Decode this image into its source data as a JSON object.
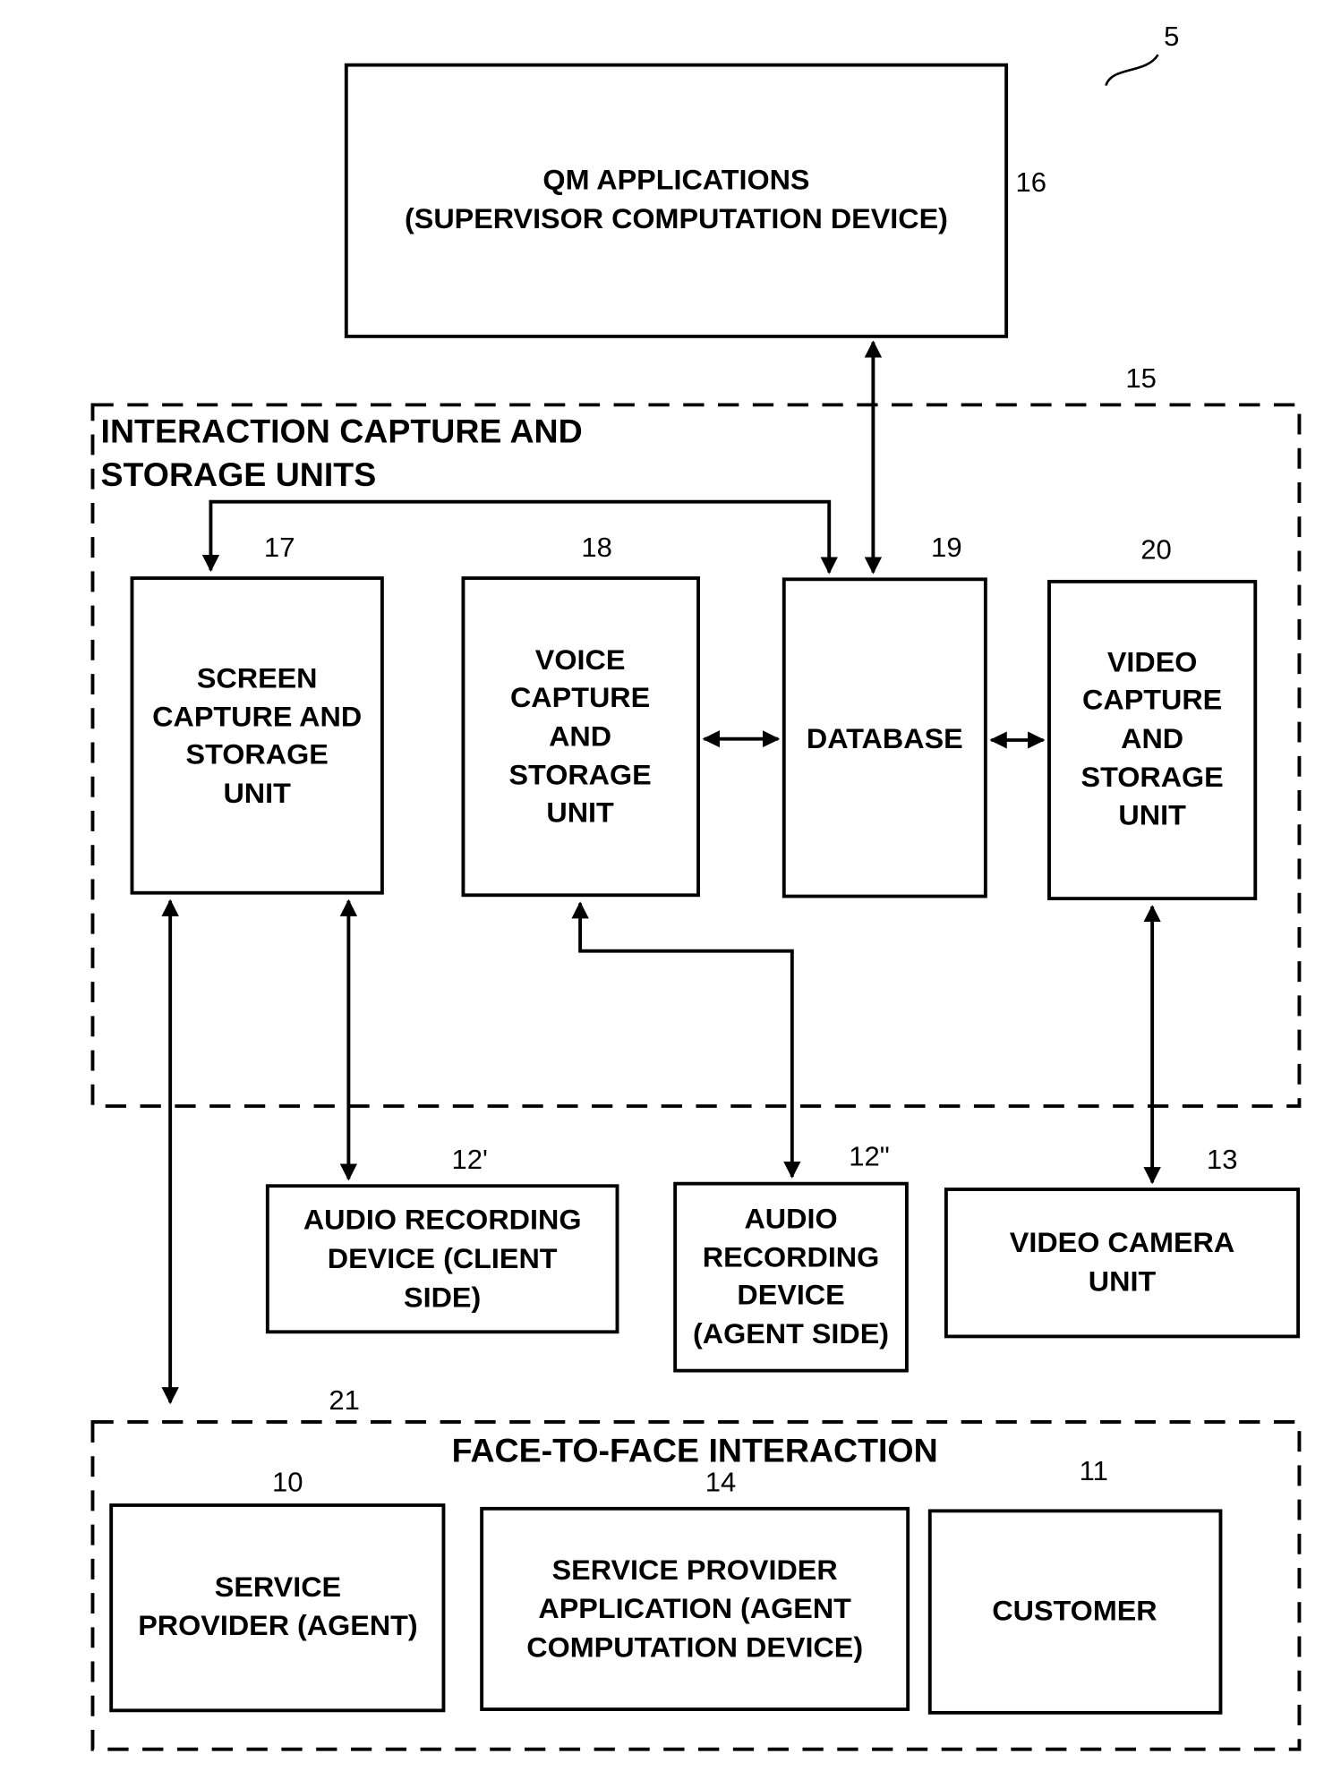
{
  "figure": {
    "ref": "5",
    "colors": {
      "ink": "#000000",
      "background": "#ffffff"
    }
  },
  "nodes": {
    "qm": {
      "ref": "16",
      "lines": [
        "QM APPLICATIONS",
        "(SUPERVISOR COMPUTATION DEVICE)"
      ]
    },
    "capture_group": {
      "ref": "15",
      "lines": [
        "INTERACTION CAPTURE AND",
        "STORAGE UNITS"
      ]
    },
    "screen": {
      "ref": "17",
      "lines": [
        "SCREEN",
        "CAPTURE AND",
        "STORAGE",
        "UNIT"
      ]
    },
    "voice": {
      "ref": "18",
      "lines": [
        "VOICE",
        "CAPTURE",
        "AND",
        "STORAGE",
        "UNIT"
      ]
    },
    "database": {
      "ref": "19",
      "lines": [
        "DATABASE"
      ]
    },
    "video": {
      "ref": "20",
      "lines": [
        "VIDEO",
        "CAPTURE",
        "AND",
        "STORAGE",
        "UNIT"
      ]
    },
    "audio_client": {
      "ref": "12'",
      "lines": [
        "AUDIO RECORDING",
        "DEVICE (CLIENT",
        "SIDE)"
      ]
    },
    "audio_agent": {
      "ref": "12\"",
      "lines": [
        "AUDIO",
        "RECORDING",
        "DEVICE",
        "(AGENT SIDE)"
      ]
    },
    "camera": {
      "ref": "13",
      "lines": [
        "VIDEO CAMERA",
        "UNIT"
      ]
    },
    "f2f_group": {
      "ref": "21",
      "lines": [
        "FACE-TO-FACE INTERACTION"
      ]
    },
    "agent": {
      "ref": "10",
      "lines": [
        "SERVICE",
        "PROVIDER (AGENT)"
      ]
    },
    "agent_app": {
      "ref": "14",
      "lines": [
        "SERVICE PROVIDER",
        "APPLICATION (AGENT",
        "COMPUTATION DEVICE)"
      ]
    },
    "customer": {
      "ref": "11",
      "lines": [
        "CUSTOMER"
      ]
    }
  },
  "edges": [
    {
      "from": "qm",
      "to": "database",
      "direction": "both"
    },
    {
      "from": "database",
      "to": "screen",
      "direction": "both"
    },
    {
      "from": "voice",
      "to": "database",
      "direction": "both"
    },
    {
      "from": "database",
      "to": "video",
      "direction": "both"
    },
    {
      "from": "screen",
      "to": "audio_client",
      "direction": "both"
    },
    {
      "from": "voice",
      "to": "audio_agent",
      "direction": "both"
    },
    {
      "from": "video",
      "to": "camera",
      "direction": "both"
    },
    {
      "from": "screen",
      "to": "f2f_group",
      "direction": "both"
    }
  ]
}
